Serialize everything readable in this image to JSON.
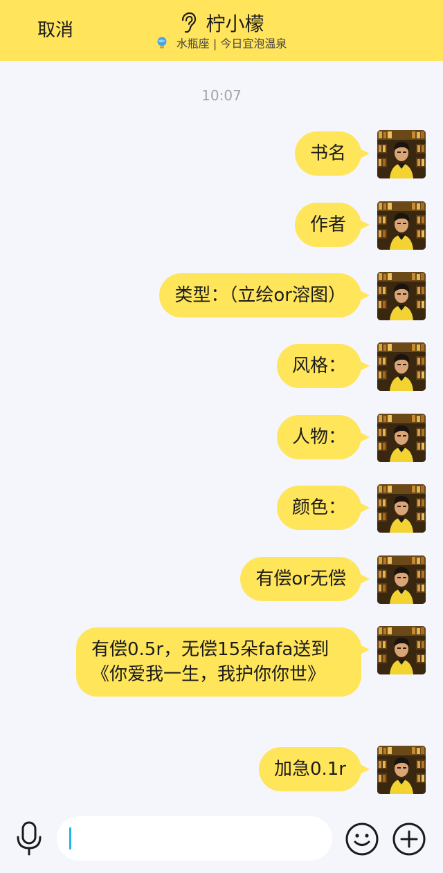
{
  "header": {
    "cancel_label": "取消",
    "contact_name": "柠小檬",
    "status_text": "水瓶座 | 今日宜泡温泉"
  },
  "chat": {
    "timestamp": "10:07",
    "messages": [
      {
        "sender": "self",
        "text": "书名"
      },
      {
        "sender": "self",
        "text": "作者"
      },
      {
        "sender": "self",
        "text": "类型：（立绘or溶图）"
      },
      {
        "sender": "self",
        "text": "风格："
      },
      {
        "sender": "self",
        "text": "人物："
      },
      {
        "sender": "self",
        "text": "颜色："
      },
      {
        "sender": "self",
        "text": "有偿or无偿"
      },
      {
        "sender": "self",
        "text": "有偿0.5r，无偿15朵fafa送到《你爱我一生，我护你你世》"
      },
      {
        "sender": "self",
        "text": "加急0.1r"
      }
    ]
  },
  "input_bar": {
    "value": "",
    "placeholder": ""
  },
  "colors": {
    "accent": "#ffe45c",
    "background": "#f4f6fb",
    "caret": "#21b4ee",
    "timestamp": "#a2a2a8"
  },
  "icons": {
    "header_title": "ear-icon",
    "status": "aquarius-globe-icon",
    "voice": "microphone-icon",
    "emoji": "smiley-icon",
    "more": "plus-circle-icon"
  }
}
